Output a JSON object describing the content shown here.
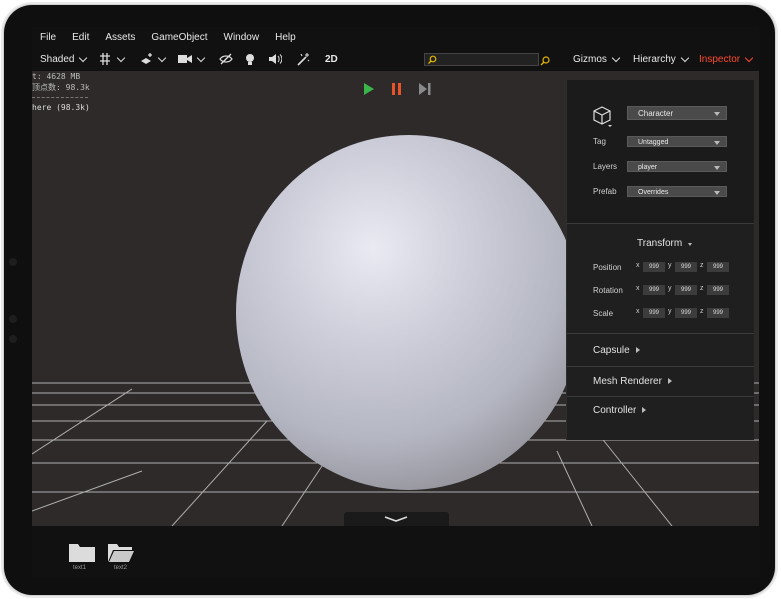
{
  "menu": [
    "File",
    "Edit",
    "Assets",
    "GameObject",
    "Window",
    "Help"
  ],
  "toolbar": {
    "shading_mode": "Shaded",
    "dimension_toggle": "2D",
    "gizmos": "Gizmos",
    "hierarchy": "Hierarchy",
    "inspector": "Inspector",
    "accent": "#ff4a2e"
  },
  "stats": {
    "memory": "t: 4628 MB",
    "vertices": "顶点数: 98.3k",
    "object": "here (98.3k)"
  },
  "playback": {
    "play_color": "#3ab54a",
    "pause_color": "#e8542a",
    "step_color": "#8a8a8a"
  },
  "inspector": {
    "object_name": "Character",
    "tag_label": "Tag",
    "tag_value": "Untagged",
    "layers_label": "Layers",
    "layers_value": "player",
    "prefab_label": "Prefab",
    "prefab_value": "Overrides",
    "transform": {
      "title": "Transform",
      "rows": [
        {
          "label": "Position",
          "x": "999",
          "y": "999",
          "z": "999"
        },
        {
          "label": "Rotation",
          "x": "999",
          "y": "999",
          "z": "999"
        },
        {
          "label": "Scale",
          "x": "999",
          "y": "999",
          "z": "999"
        }
      ]
    },
    "components": [
      "Capsule",
      "Mesh Renderer",
      "Controller"
    ]
  },
  "assets": [
    {
      "name": "text1",
      "icon": "folder-icon"
    },
    {
      "name": "text2",
      "icon": "folder-open-icon"
    }
  ]
}
